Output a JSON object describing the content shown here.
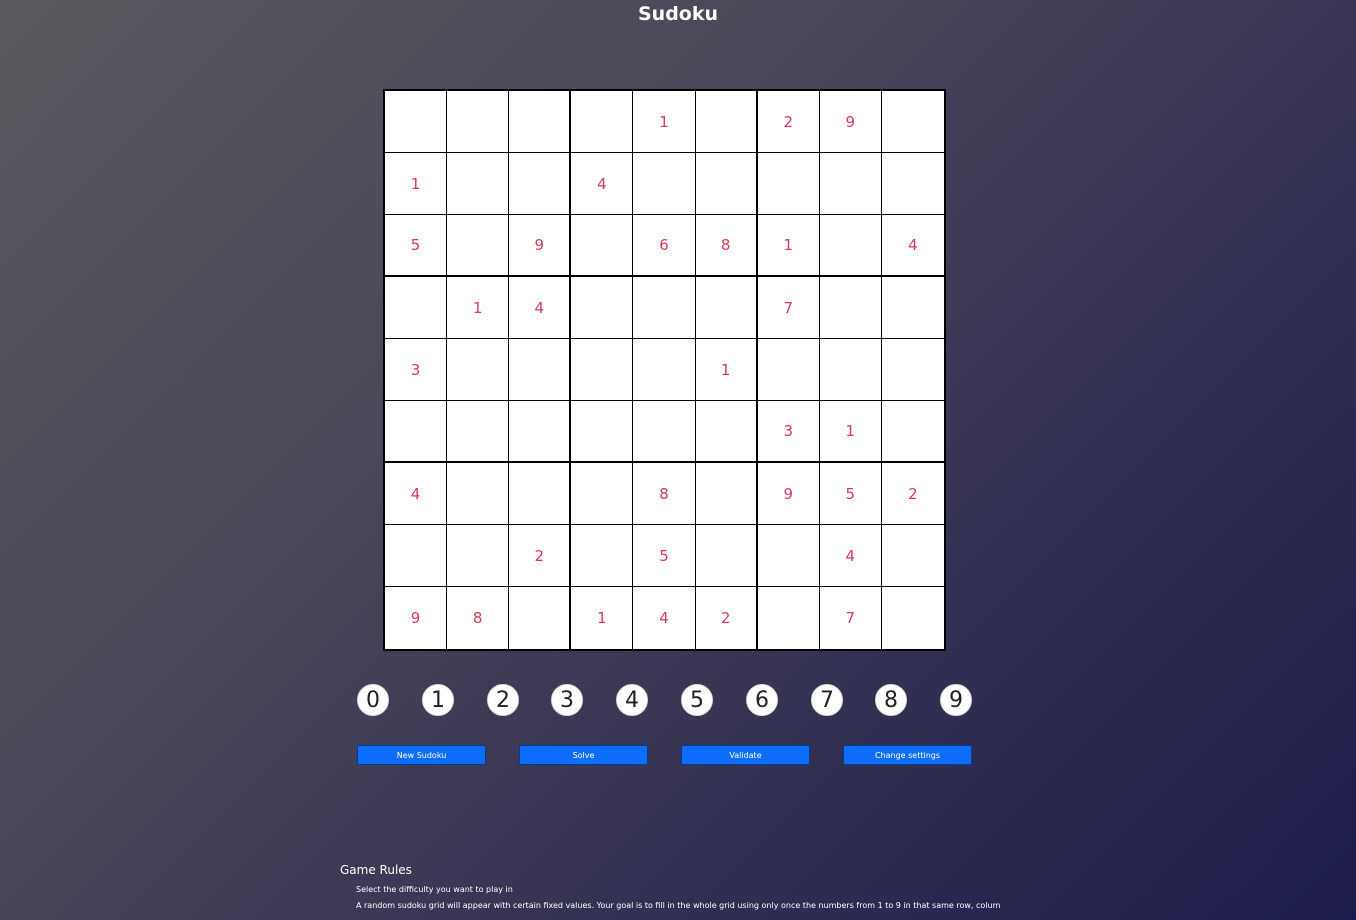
{
  "page": {
    "title": "Sudoku"
  },
  "colors": {
    "given_number": "#d23c58",
    "button_blue": "#0d6efd"
  },
  "grid": [
    [
      "",
      "",
      "",
      "",
      "1",
      "",
      "2",
      "9",
      ""
    ],
    [
      "1",
      "",
      "",
      "4",
      "",
      "",
      "",
      "",
      ""
    ],
    [
      "5",
      "",
      "9",
      "",
      "6",
      "8",
      "1",
      "",
      "4"
    ],
    [
      "",
      "1",
      "4",
      "",
      "",
      "",
      "7",
      "",
      ""
    ],
    [
      "3",
      "",
      "",
      "",
      "",
      "1",
      "",
      "",
      ""
    ],
    [
      "",
      "",
      "",
      "",
      "",
      "",
      "3",
      "1",
      ""
    ],
    [
      "4",
      "",
      "",
      "",
      "8",
      "",
      "9",
      "5",
      "2"
    ],
    [
      "",
      "",
      "2",
      "",
      "5",
      "",
      "",
      "4",
      ""
    ],
    [
      "9",
      "8",
      "",
      "1",
      "4",
      "2",
      "",
      "7",
      ""
    ]
  ],
  "numpad": [
    "0",
    "1",
    "2",
    "3",
    "4",
    "5",
    "6",
    "7",
    "8",
    "9"
  ],
  "actions": [
    {
      "label": "New Sudoku",
      "name": "new-sudoku-button"
    },
    {
      "label": "Solve",
      "name": "solve-button"
    },
    {
      "label": "Validate",
      "name": "validate-button"
    },
    {
      "label": "Change settings",
      "name": "change-settings-button"
    }
  ],
  "rules": {
    "title": "Game Rules",
    "items": [
      "Select the difficulty you want to play in",
      "A random sudoku grid will appear with certain fixed values. Your goal is to fill in the whole grid using only once the numbers from 1 to 9 in that same row, column and"
    ]
  }
}
